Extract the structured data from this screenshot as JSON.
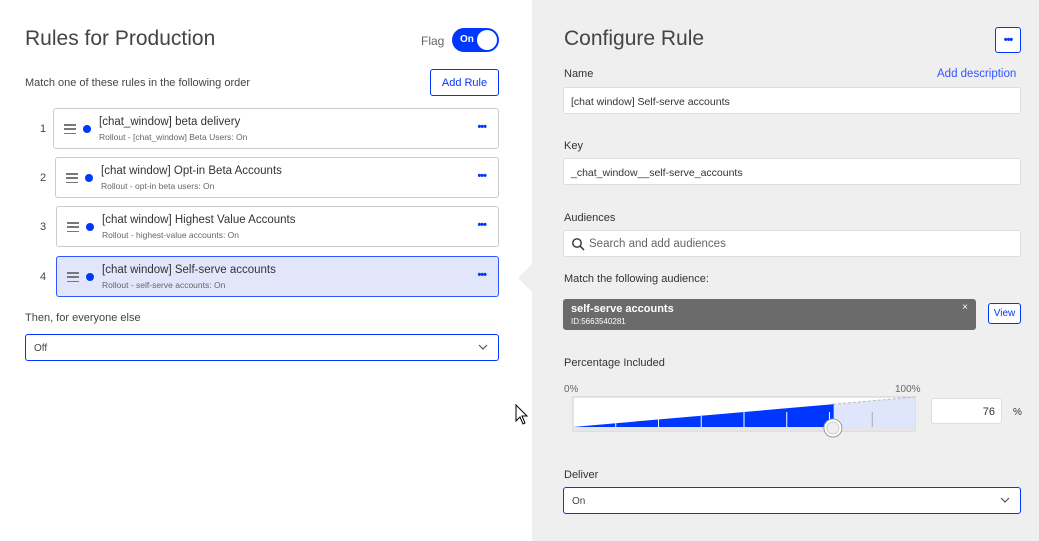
{
  "left": {
    "title": "Rules for Production",
    "flag_label": "Flag",
    "toggle_label": "On",
    "match_text": "Match one of these rules in the following order",
    "add_rule_label": "Add Rule",
    "rules": [
      {
        "num": "1",
        "title": "[chat_window] beta delivery",
        "subtitle": "Rollout - [chat_window] Beta Users: On"
      },
      {
        "num": "2",
        "title": "[chat window] Opt-in Beta Accounts",
        "subtitle": "Rollout - opt-in beta users: On"
      },
      {
        "num": "3",
        "title": "[chat window] Highest Value Accounts",
        "subtitle": "Rollout - highest-value accounts: On"
      },
      {
        "num": "4",
        "title": "[chat window] Self-serve accounts",
        "subtitle": "Rollout - self-serve accounts: On"
      }
    ],
    "else_label": "Then, for everyone else",
    "else_value": "Off"
  },
  "right": {
    "title": "Configure Rule",
    "name_label": "Name",
    "add_description": "Add description",
    "name_value": "[chat window] Self-serve accounts",
    "key_label": "Key",
    "key_value": "_chat_window__self-serve_accounts",
    "audiences_label": "Audiences",
    "audiences_placeholder": "Search and add audiences",
    "match_audience_label": "Match the following audience:",
    "audience_chip": {
      "name": "self-serve accounts",
      "id": "ID:5663540281",
      "remove": "×"
    },
    "view_label": "View",
    "percentage_label": "Percentage Included",
    "pct_min": "0%",
    "pct_max": "100%",
    "percentage_value": 76,
    "percentage_text": "76",
    "percent_sign": "%",
    "deliver_label": "Deliver",
    "deliver_value": "On"
  },
  "colors": {
    "accent": "#0037ff",
    "right_panel_bg": "#efefef",
    "active_rule_bg": "#e1e6fb",
    "chip_bg": "#6b6b6b"
  },
  "icons": [
    "drag-handle-icon",
    "more-icon",
    "chevron-down-icon",
    "search-icon",
    "close-icon",
    "mouse-cursor-icon"
  ]
}
